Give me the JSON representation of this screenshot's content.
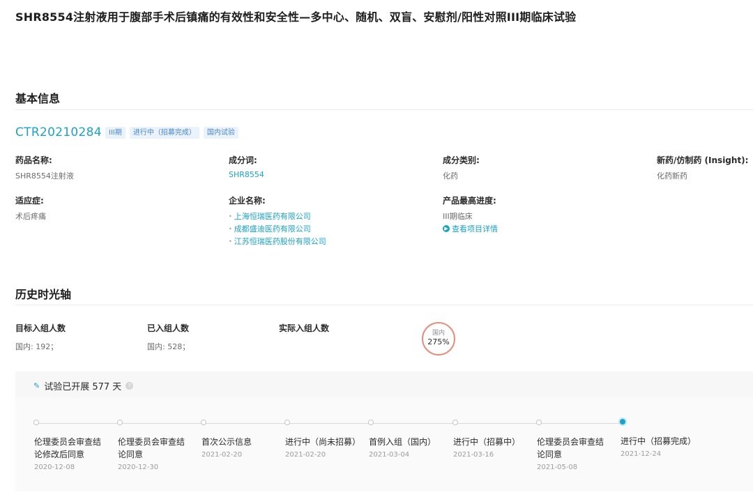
{
  "page_title": "SHR8554注射液用于腹部手术后镇痛的有效性和安全性—多中心、随机、双盲、安慰剂/阳性对照III期临床试验",
  "basic_info": {
    "section_title": "基本信息",
    "ctr_id": "CTR20210284",
    "tags": [
      "III期",
      "进行中（招募完成）",
      "国内试验"
    ],
    "drug_name_label": "药品名称:",
    "drug_name_value": "SHR8554注射液",
    "ingredient_label": "成分词:",
    "ingredient_value": "SHR8554",
    "category_label": "成分类别:",
    "category_value": "化药",
    "new_generic_label": "新药/仿制药 (Insight):",
    "new_generic_value": "化药新药",
    "indication_label": "适应症:",
    "indication_value": "术后疼痛",
    "company_label": "企业名称:",
    "companies": [
      "上海恒瑞医药有限公司",
      "成都盛迪医药有限公司",
      "江苏恒瑞医药股份有限公司"
    ],
    "progress_label": "产品最高进度:",
    "progress_value": "III期临床",
    "detail_link": "查看项目详情"
  },
  "history": {
    "section_title": "历史时光轴",
    "target_label": "目标入组人数",
    "target_value": "国内: 192；",
    "enrolled_label": "已入组人数",
    "enrolled_value": "国内: 528；",
    "actual_label": "实际入组人数",
    "pct_region": "国内",
    "pct_value": "275%",
    "duration_text": "试验已开展 577 天",
    "events": [
      {
        "label": "伦理委员会审查结论修改后同意",
        "date": "2020-12-08"
      },
      {
        "label": "伦理委员会审查结论同意",
        "date": "2020-12-30"
      },
      {
        "label": "首次公示信息",
        "date": "2021-02-20"
      },
      {
        "label": "进行中（尚未招募）",
        "date": "2021-02-20"
      },
      {
        "label": "首例入组（国内）",
        "date": "2021-03-04"
      },
      {
        "label": "进行中（招募中）",
        "date": "2021-03-16"
      },
      {
        "label": "伦理委员会审查结论同意",
        "date": "2021-05-08"
      },
      {
        "label": "进行中（招募完成）",
        "date": "2021-12-24"
      }
    ]
  },
  "colors": {
    "accent": "#1aa3c7",
    "tag_bg": "#eaf2fb",
    "circle_border": "#e58d7d"
  },
  "icons": {
    "duration": "pencil-icon",
    "help": "help-icon",
    "detail": "arrow-circle-icon"
  }
}
